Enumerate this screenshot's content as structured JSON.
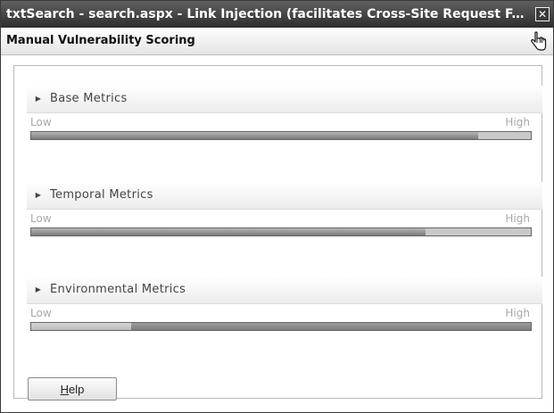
{
  "window": {
    "title": "txtSearch - search.aspx - Link Injection (facilitates Cross-Site Request F...",
    "close_glyph": "✕",
    "subtitle": "Manual Vulnerability Scoring"
  },
  "sections": [
    {
      "label": "Base Metrics",
      "low": "Low",
      "high": "High",
      "level": 0.895
    },
    {
      "label": "Temporal Metrics",
      "low": "Low",
      "high": "High",
      "level": 0.79
    },
    {
      "label": "Environmental Metrics",
      "low": "Low",
      "high": "High",
      "level": 0.2
    }
  ],
  "help_button": {
    "label_rest": "elp",
    "label_mnemonic": "H"
  },
  "icons": {
    "close": "close-icon",
    "cursor": "hand-cursor-icon",
    "expand": "triangle-right-icon"
  },
  "colors": {
    "titlebar": "#404040",
    "bar_fill": "#7a7a7a",
    "bar_track": "#c8c8c8"
  }
}
